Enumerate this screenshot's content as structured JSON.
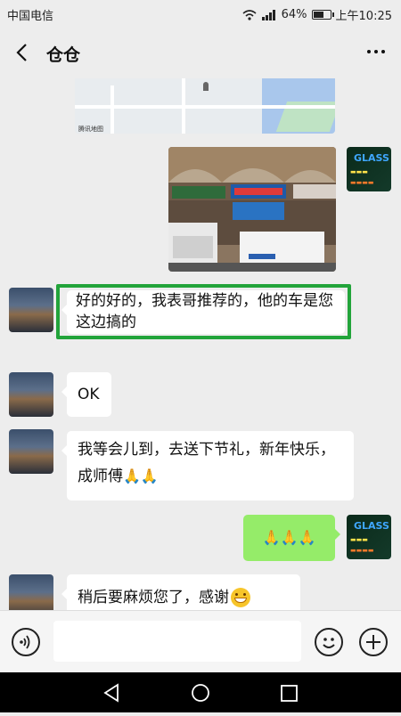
{
  "status_bar": {
    "carrier": "中国电信",
    "battery_text": "64%",
    "battery_level": 0.64,
    "time": "上午10:25"
  },
  "header": {
    "back_icon": "chevron-left-icon",
    "title": "仓仓",
    "more_icon": "more-dots-icon"
  },
  "messages": {
    "map_provider": "腾讯地图",
    "m1_text": "好的好的，我表哥推荐的，他的车是您这边搞的",
    "m2_text": "OK",
    "m3_text": "我等会儿到，去送下节礼，新年快乐，成师傅",
    "m3_emoji": "🙏🙏",
    "m4_emoji": "🙏🙏🙏",
    "m5_text": "稍后要麻烦您了，感谢"
  },
  "self_avatar": {
    "brand": "GLASS"
  },
  "input_bar": {
    "voice_icon": "voice-icon",
    "emoji_icon": "emoji-icon",
    "plus_icon": "plus-icon"
  },
  "colors": {
    "background": "#ededed",
    "sent_bubble": "#95ec69",
    "highlight_border": "#22a43a"
  }
}
